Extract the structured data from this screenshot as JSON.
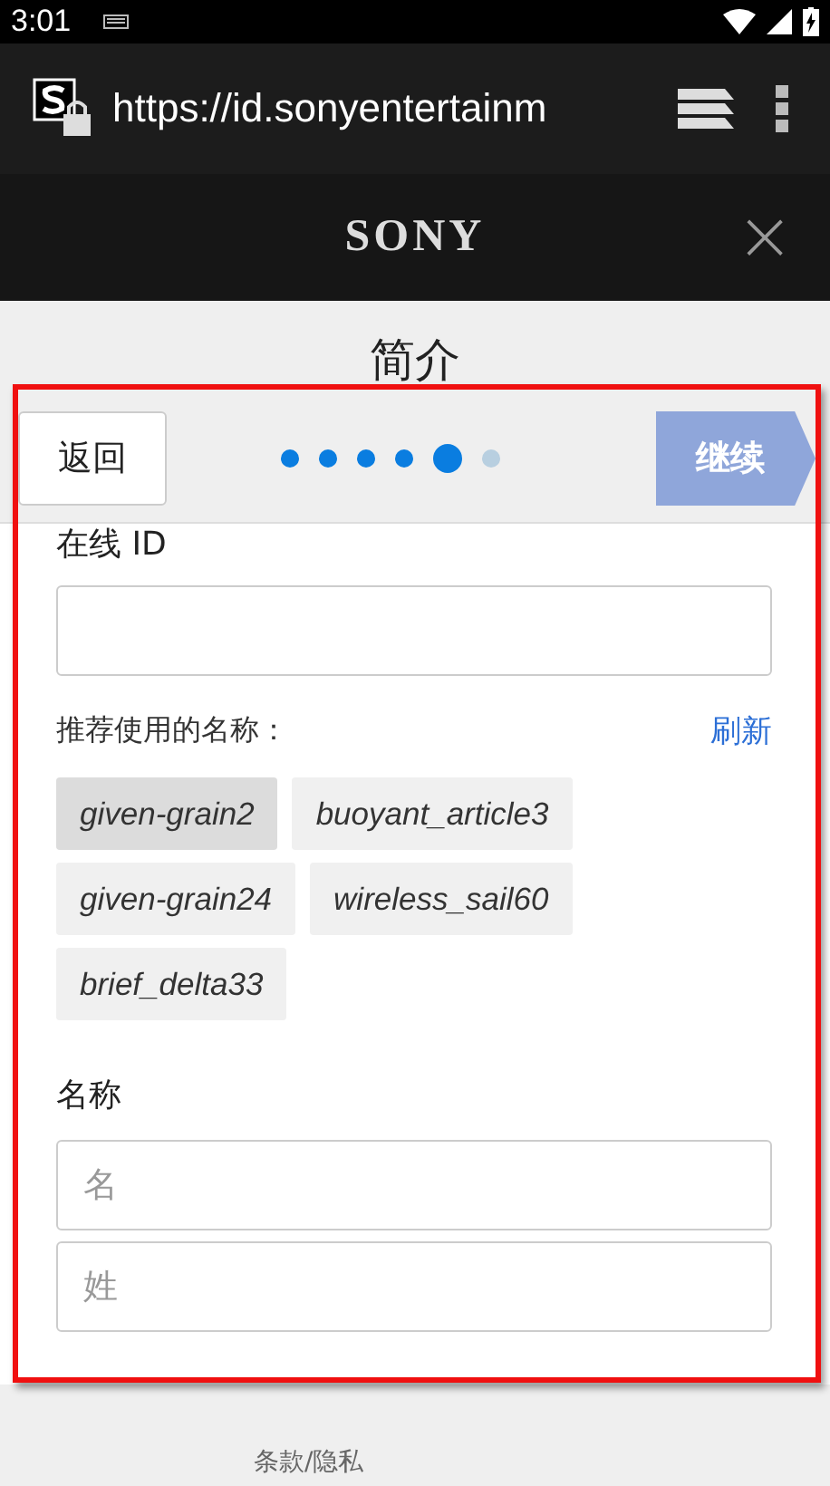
{
  "status_bar": {
    "time": "3:01"
  },
  "browser": {
    "url": "https://id.sonyentertainm"
  },
  "header": {
    "logo": "SONY",
    "close": "×"
  },
  "page_title": "简介",
  "nav": {
    "back": "返回",
    "next": "继续",
    "next_disabled": true,
    "steps": [
      {
        "selected": false
      },
      {
        "selected": false
      },
      {
        "selected": false
      },
      {
        "selected": false
      },
      {
        "selected": true
      },
      {
        "selected": false
      }
    ]
  },
  "online_id": {
    "label": "在线 ID"
  },
  "suggestions": {
    "label": "推荐使用的名称：",
    "refresh": "刷新",
    "items": [
      {
        "text": "given-grain2",
        "selected": true
      },
      {
        "text": "buoyant_article3",
        "selected": false
      },
      {
        "text": "given-grain24",
        "selected": false
      },
      {
        "text": "wireless_sail60",
        "selected": false
      },
      {
        "text": "brief_delta33",
        "selected": false
      }
    ]
  },
  "name": {
    "label": "名称",
    "first_placeholder": "名",
    "last_placeholder": "姓"
  },
  "footer": "条款/隐私"
}
